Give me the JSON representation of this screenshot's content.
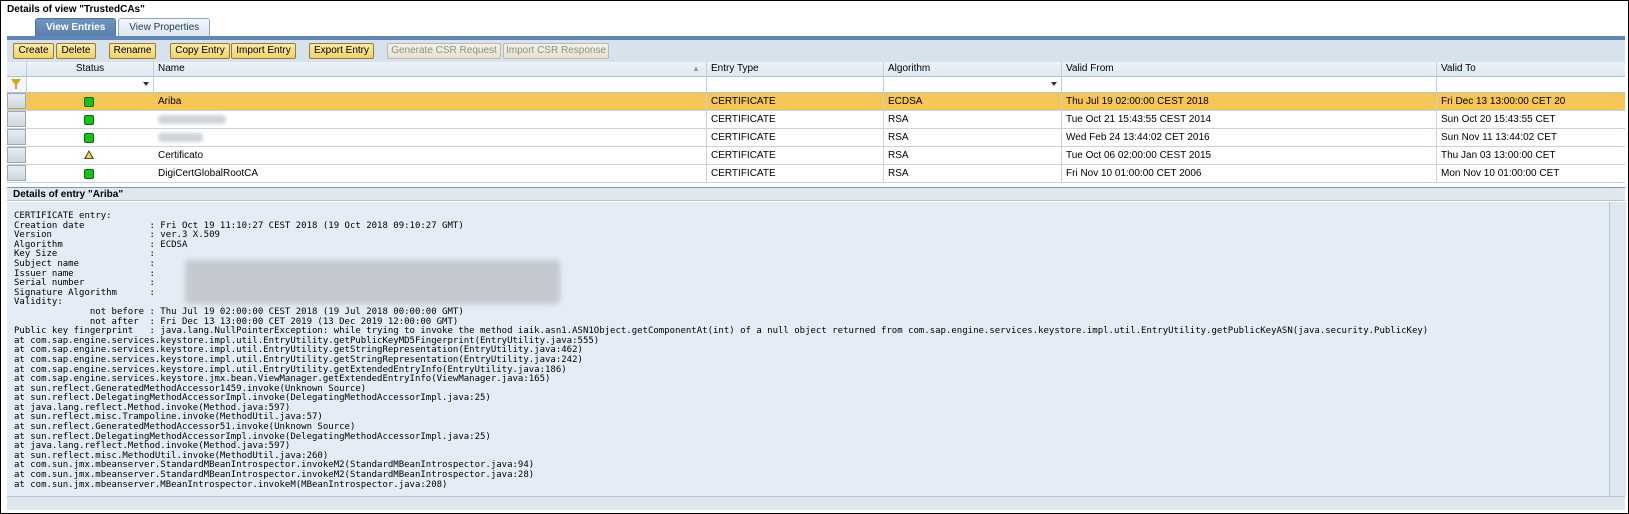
{
  "view": {
    "title": "Details of view \"TrustedCAs\"",
    "tabs": [
      {
        "label": "View Entries",
        "active": true
      },
      {
        "label": "View Properties",
        "active": false
      }
    ]
  },
  "toolbar": {
    "buttons": [
      {
        "label": "Create",
        "enabled": true
      },
      {
        "label": "Delete",
        "enabled": true
      },
      {
        "label": "Rename",
        "enabled": true
      },
      {
        "label": "Copy Entry",
        "enabled": true
      },
      {
        "label": "Import Entry",
        "enabled": true
      },
      {
        "label": "Export Entry",
        "enabled": true
      },
      {
        "label": "Generate CSR Request",
        "enabled": false
      },
      {
        "label": "Import CSR Response",
        "enabled": false
      }
    ]
  },
  "table": {
    "columns": [
      "Status",
      "Name",
      "Entry Type",
      "Algorithm",
      "Valid From",
      "Valid To"
    ],
    "rows": [
      {
        "status": "green",
        "name": "Ariba",
        "entry_type": "CERTIFICATE",
        "algorithm": "ECDSA",
        "valid_from": "Thu Jul 19 02:00:00 CEST 2018",
        "valid_to": "Fri Dec 13 13:00:00 CET 20",
        "selected": true
      },
      {
        "status": "green",
        "name": "",
        "entry_type": "CERTIFICATE",
        "algorithm": "RSA",
        "valid_from": "Tue Oct 21 15:43:55 CEST 2014",
        "valid_to": "Sun Oct 20 15:43:55 CET",
        "selected": false
      },
      {
        "status": "green",
        "name": "",
        "entry_type": "CERTIFICATE",
        "algorithm": "RSA",
        "valid_from": "Wed Feb 24 13:44:02 CET 2016",
        "valid_to": "Sun Nov 11 13:44:02 CET",
        "selected": false
      },
      {
        "status": "warning",
        "name": "Certificato",
        "entry_type": "CERTIFICATE",
        "algorithm": "RSA",
        "valid_from": "Tue Oct 06 02:00:00 CEST 2015",
        "valid_to": "Thu Jan 03 13:00:00 CET",
        "selected": false
      },
      {
        "status": "green",
        "name": "DigiCertGlobalRootCA",
        "entry_type": "CERTIFICATE",
        "algorithm": "RSA",
        "valid_from": "Fri Nov 10 01:00:00 CET 2006",
        "valid_to": "Mon Nov 10 01:00:00 CET",
        "selected": false
      }
    ]
  },
  "details": {
    "title": "Details of entry \"Ariba\"",
    "text": "CERTIFICATE entry:\nCreation date            : Fri Oct 19 11:10:27 CEST 2018 (19 Oct 2018 09:10:27 GMT)\nVersion                  : ver.3 X.509\nAlgorithm                : ECDSA\nKey Size                 :\nSubject name             :\nIssuer name              :\nSerial number            :\nSignature Algorithm      :\nValidity:\n              not before : Thu Jul 19 02:00:00 CEST 2018 (19 Jul 2018 00:00:00 GMT)\n              not after  : Fri Dec 13 13:00:00 CET 2019 (13 Dec 2019 12:00:00 GMT)\nPublic key fingerprint   : java.lang.NullPointerException: while trying to invoke the method iaik.asn1.ASN1Object.getComponentAt(int) of a null object returned from com.sap.engine.services.keystore.impl.util.EntryUtility.getPublicKeyASN(java.security.PublicKey)\nat com.sap.engine.services.keystore.impl.util.EntryUtility.getPublicKeyMD5Fingerprint(EntryUtility.java:555)\nat com.sap.engine.services.keystore.impl.util.EntryUtility.getStringRepresentation(EntryUtility.java:462)\nat com.sap.engine.services.keystore.impl.util.EntryUtility.getStringRepresentation(EntryUtility.java:242)\nat com.sap.engine.services.keystore.impl.util.EntryUtility.getExtendedEntryInfo(EntryUtility.java:186)\nat com.sap.engine.services.keystore.jmx.bean.ViewManager.getExtendedEntryInfo(ViewManager.java:165)\nat sun.reflect.GeneratedMethodAccessor1459.invoke(Unknown Source)\nat sun.reflect.DelegatingMethodAccessorImpl.invoke(DelegatingMethodAccessorImpl.java:25)\nat java.lang.reflect.Method.invoke(Method.java:597)\nat sun.reflect.misc.Trampoline.invoke(MethodUtil.java:57)\nat sun.reflect.GeneratedMethodAccessor51.invoke(Unknown Source)\nat sun.reflect.DelegatingMethodAccessorImpl.invoke(DelegatingMethodAccessorImpl.java:25)\nat java.lang.reflect.Method.invoke(Method.java:597)\nat sun.reflect.misc.MethodUtil.invoke(MethodUtil.java:260)\nat com.sun.jmx.mbeanserver.StandardMBeanIntrospector.invokeM2(StandardMBeanIntrospector.java:94)\nat com.sun.jmx.mbeanserver.StandardMBeanIntrospector.invokeM2(StandardMBeanIntrospector.java:28)\nat com.sun.jmx.mbeanserver.MBeanIntrospector.invokeM(MBeanIntrospector.java:208)"
  }
}
